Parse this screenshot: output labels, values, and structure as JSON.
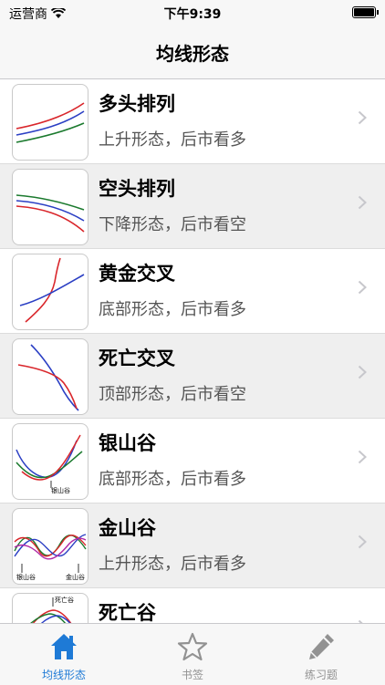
{
  "status_bar": {
    "carrier": "运营商",
    "time": "下午9:39"
  },
  "navbar": {
    "title": "均线形态"
  },
  "rows": [
    {
      "title": "多头排列",
      "subtitle": "上升形态，后市看多"
    },
    {
      "title": "空头排列",
      "subtitle": "下降形态，后市看空"
    },
    {
      "title": "黄金交叉",
      "subtitle": "底部形态，后市看多"
    },
    {
      "title": "死亡交叉",
      "subtitle": "顶部形态，后市看空"
    },
    {
      "title": "银山谷",
      "subtitle": "底部形态，后市看多",
      "thumb_label": "银山谷"
    },
    {
      "title": "金山谷",
      "subtitle": "上升形态，后市看多",
      "thumb_labels": [
        "银山谷",
        "金山谷"
      ]
    },
    {
      "title": "死亡谷",
      "subtitle": "",
      "thumb_label": "死亡谷"
    }
  ],
  "tabs": [
    {
      "label": "均线形态",
      "icon": "home-icon",
      "active": true
    },
    {
      "label": "书签",
      "icon": "star-icon",
      "active": false
    },
    {
      "label": "练习题",
      "icon": "pencil-icon",
      "active": false
    }
  ],
  "colors": {
    "accent": "#1e7ad6",
    "red": "#d9262b",
    "blue": "#2b3fc4",
    "green": "#1b7a2e",
    "purple": "#b02aa6"
  }
}
